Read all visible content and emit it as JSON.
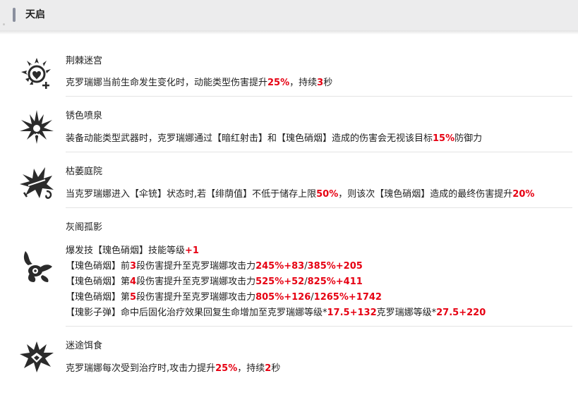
{
  "header": {
    "title": "天启"
  },
  "sections": [
    {
      "icon": "thorn-labyrinth-icon",
      "title": "荆棘迷宫",
      "desc": [
        [
          {
            "t": "克罗瑞娜当前生命发生变化时，动能类型伤害提升"
          },
          {
            "t": "25%",
            "h": true
          },
          {
            "t": "，持续"
          },
          {
            "t": "3",
            "h": true
          },
          {
            "t": "秒"
          }
        ]
      ]
    },
    {
      "icon": "rusty-fountain-icon",
      "title": "锈色喷泉",
      "desc": [
        [
          {
            "t": "装备动能类型武器时，克罗瑞娜通过【暗红射击】和【瑰色硝烟】造成的伤害会无视该目标"
          },
          {
            "t": "15%",
            "h": true
          },
          {
            "t": "防御力"
          }
        ]
      ]
    },
    {
      "icon": "withered-courtyard-icon",
      "title": "枯萎庭院",
      "desc": [
        [
          {
            "t": "当克罗瑞娜进入【伞铳】状态时,若【绯荫值】不低于储存上限"
          },
          {
            "t": "50%",
            "h": true
          },
          {
            "t": "，则该次【瑰色硝烟】造成的最终伤害提升"
          },
          {
            "t": "20%",
            "h": true
          }
        ]
      ]
    },
    {
      "icon": "ash-pavilion-icon",
      "title": "灰阁孤影",
      "desc": [
        [
          {
            "t": "爆发技【瑰色硝烟】技能等级"
          },
          {
            "t": "+1",
            "h": true
          }
        ],
        [
          {
            "t": "【瑰色硝烟】前"
          },
          {
            "t": "3",
            "h": true
          },
          {
            "t": "段伤害提升至克罗瑞娜攻击力"
          },
          {
            "t": "245%+83",
            "h": true
          },
          {
            "t": "/"
          },
          {
            "t": "385%+205",
            "h": true
          }
        ],
        [
          {
            "t": "【瑰色硝烟】第"
          },
          {
            "t": "4",
            "h": true
          },
          {
            "t": "段伤害提升至克罗瑞娜攻击力"
          },
          {
            "t": "525%+52",
            "h": true
          },
          {
            "t": "/"
          },
          {
            "t": "825%+411",
            "h": true
          }
        ],
        [
          {
            "t": "【瑰色硝烟】第"
          },
          {
            "t": "5",
            "h": true
          },
          {
            "t": "段伤害提升至克罗瑞娜攻击力"
          },
          {
            "t": "805%+126",
            "h": true
          },
          {
            "t": "/"
          },
          {
            "t": "1265%+1742",
            "h": true
          }
        ],
        [
          {
            "t": "【瑰影子弹】命中后固化治疗效果回复生命增加至克罗瑞娜等级*"
          },
          {
            "t": "17.5+132",
            "h": true
          },
          {
            "t": "克罗瑞娜等级*"
          },
          {
            "t": "27.5+220",
            "h": true
          }
        ]
      ]
    },
    {
      "icon": "lost-bait-icon",
      "title": "迷途饵食",
      "desc": [
        [
          {
            "t": "克罗瑞娜每次受到治疗时,攻击力提升"
          },
          {
            "t": "25%",
            "h": true
          },
          {
            "t": "，持续"
          },
          {
            "t": "2",
            "h": true
          },
          {
            "t": "秒"
          }
        ]
      ]
    }
  ]
}
